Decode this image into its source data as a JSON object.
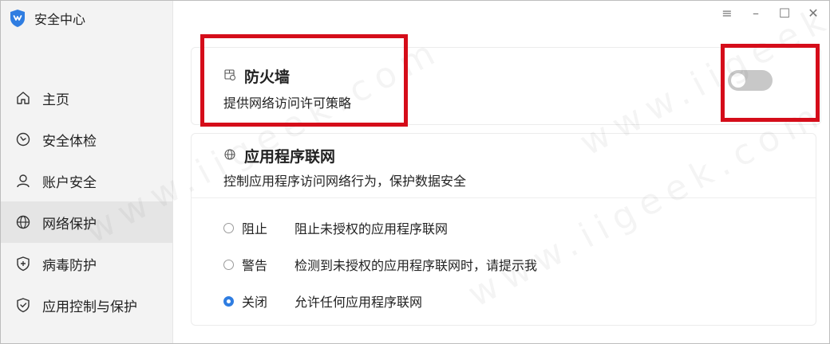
{
  "app": {
    "title": "安全中心"
  },
  "window_controls": {
    "menu": "≡",
    "minimize": "–",
    "maximize": "☐",
    "close": "✕"
  },
  "sidebar": {
    "items": [
      {
        "label": "主页",
        "icon": "home-icon",
        "active": false
      },
      {
        "label": "安全体检",
        "icon": "clock-icon",
        "active": false
      },
      {
        "label": "账户安全",
        "icon": "user-icon",
        "active": false
      },
      {
        "label": "网络保护",
        "icon": "globe-icon",
        "active": true
      },
      {
        "label": "病毒防护",
        "icon": "shield-plus-icon",
        "active": false
      },
      {
        "label": "应用控制与保护",
        "icon": "shield-check-icon",
        "active": false
      }
    ]
  },
  "firewall": {
    "title": "防火墙",
    "description": "提供网络访问许可策略",
    "icon": "firewall-icon",
    "enabled": false
  },
  "app_network": {
    "title": "应用程序联网",
    "description": "控制应用程序访问网络行为，保护数据安全",
    "icon": "globe-icon",
    "options": [
      {
        "label": "阻止",
        "description": "阻止未授权的应用程序联网",
        "selected": false
      },
      {
        "label": "警告",
        "description": "检测到未授权的应用程序联网时，请提示我",
        "selected": false
      },
      {
        "label": "关闭",
        "description": "允许任何应用程序联网",
        "selected": true
      }
    ]
  },
  "colors": {
    "accent": "#2f7de1",
    "annotation": "#d50d1a",
    "sidebar_bg": "#f3f3f3",
    "active_bg": "#e5e5e5",
    "toggle_off": "#c8c8c8"
  },
  "watermark": "www.iigeek.com"
}
